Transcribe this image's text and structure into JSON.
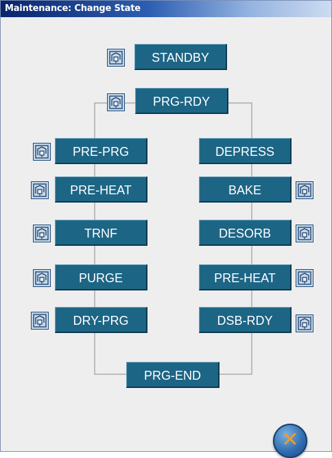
{
  "window": {
    "title": "Maintenance: Change State"
  },
  "states": {
    "standby": "STANDBY",
    "prg_rdy": "PRG-RDY",
    "pre_prg": "PRE-PRG",
    "pre_heat_left": "PRE-HEAT",
    "trnf": "TRNF",
    "purge": "PURGE",
    "dry_prg": "DRY-PRG",
    "depress": "DEPRESS",
    "bake": "BAKE",
    "desorb": "DESORB",
    "pre_heat_right": "PRE-HEAT",
    "dsb_rdy": "DSB-RDY",
    "prg_end": "PRG-END"
  },
  "icons": {
    "state_diagram": "state-diagram-icon",
    "close": "close-icon"
  },
  "colors": {
    "button": "#1d6585",
    "button_text": "#ffffff",
    "icon_bg": "#c6d9ea",
    "connector": "#8a8a8a",
    "close_x": "#f39c1f"
  }
}
